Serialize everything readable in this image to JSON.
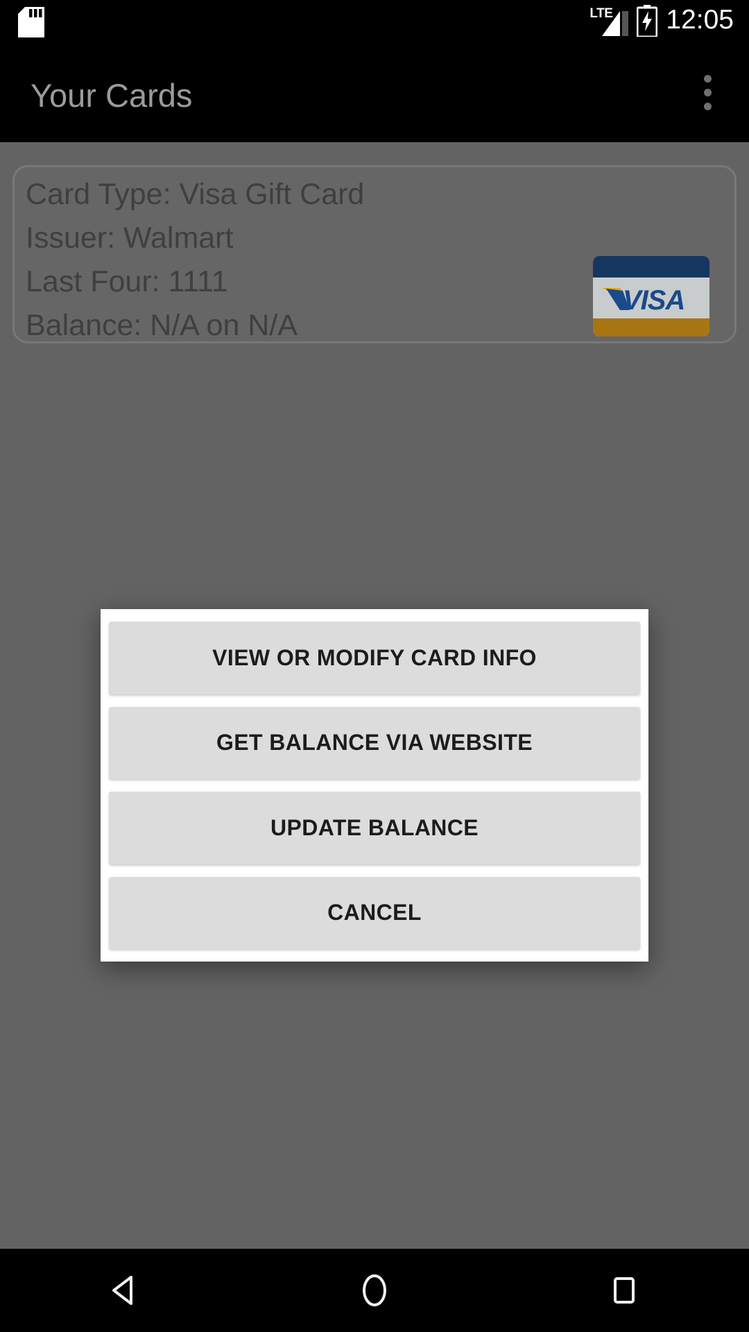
{
  "status_bar": {
    "sd_card_icon": "sd-card-icon",
    "network_label": "LTE",
    "signal_icon": "signal-bars-icon",
    "battery_icon": "battery-charging-icon",
    "clock": "12:05"
  },
  "app_bar": {
    "title": "Your Cards",
    "overflow_icon": "overflow-menu-icon"
  },
  "card": {
    "lines": [
      "Card Type:  Visa Gift Card",
      "Issuer:  Walmart",
      "Last Four:  1111",
      "Balance:  N/A on N/A"
    ],
    "card_type_label": "Card Type:",
    "card_type_value": "Visa Gift Card",
    "issuer_label": "Issuer:",
    "issuer_value": "Walmart",
    "last_four_label": "Last Four:",
    "last_four_value": "1111",
    "balance_label": "Balance:",
    "balance_value": "N/A on N/A",
    "brand_logo": "visa-logo",
    "brand_wordmark": "VISA",
    "brand_colors": {
      "navy": "#15365f",
      "gold": "#a87512",
      "face": "#c9cccd"
    }
  },
  "dialog": {
    "buttons": [
      {
        "label": "VIEW OR MODIFY CARD INFO",
        "name": "view-or-modify-card-info-button"
      },
      {
        "label": "GET BALANCE VIA WEBSITE",
        "name": "get-balance-via-website-button"
      },
      {
        "label": "UPDATE BALANCE",
        "name": "update-balance-button"
      },
      {
        "label": "CANCEL",
        "name": "cancel-button"
      }
    ]
  },
  "nav_bar": {
    "back_icon": "back-triangle-icon",
    "home_icon": "home-circle-icon",
    "recents_icon": "recents-square-icon"
  },
  "theme": {
    "scrim": "#636363",
    "dialog_bg": "#ffffff",
    "button_bg": "#dcdcdc",
    "system_bar": "#000000"
  }
}
